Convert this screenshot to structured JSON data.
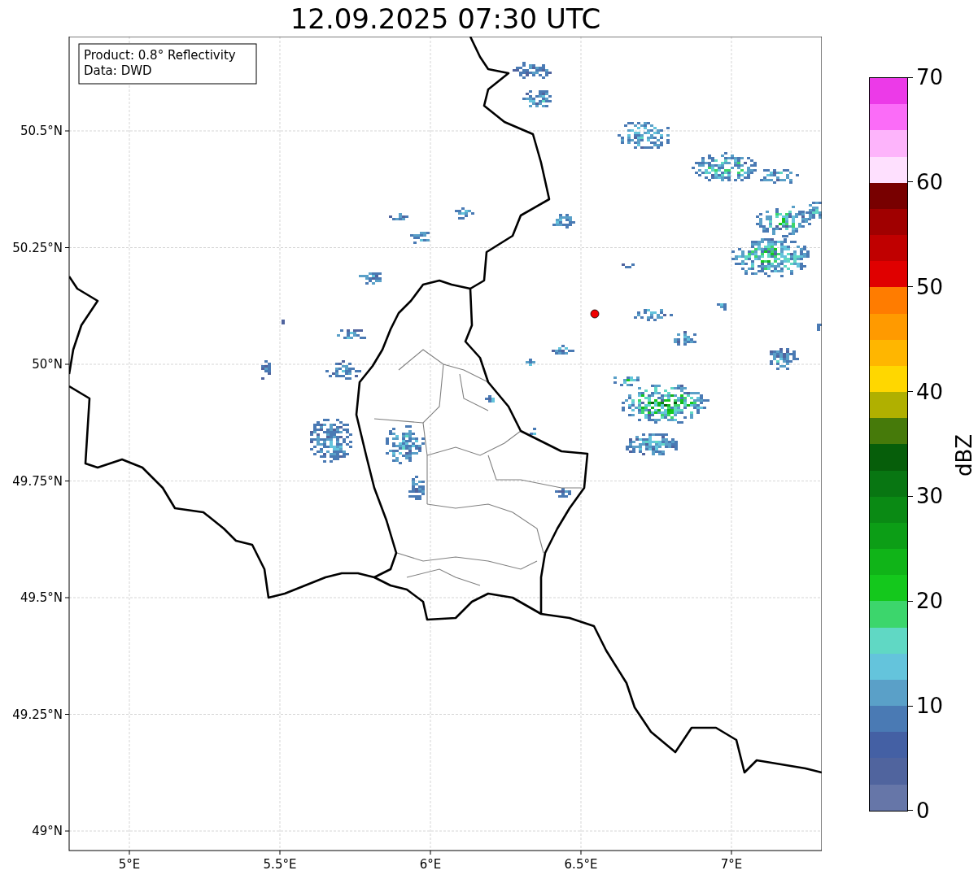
{
  "title": "12.09.2025 07:30 UTC",
  "legend": [
    "Product: 0.8° Reflectivity",
    "Data: DWD"
  ],
  "map": {
    "xticks": [
      "5°E",
      "5.5°E",
      "6°E",
      "6.5°E",
      "7°E"
    ],
    "yticks": [
      "50.5°N",
      "50.25°N",
      "50°N",
      "49.75°N",
      "49.5°N",
      "49.25°N",
      "49°N"
    ]
  },
  "colorbar": {
    "label": "dBZ",
    "ticks": [
      "70",
      "60",
      "50",
      "40",
      "30",
      "20",
      "10",
      "0"
    ],
    "segments": [
      {
        "color": "#ec3ae8"
      },
      {
        "color": "#fb6cf8"
      },
      {
        "color": "#fdb4fb"
      },
      {
        "color": "#fee0fe"
      },
      {
        "color": "#780000"
      },
      {
        "color": "#a00000"
      },
      {
        "color": "#c00000"
      },
      {
        "color": "#e00000"
      },
      {
        "color": "#ff7c00"
      },
      {
        "color": "#ff9a00"
      },
      {
        "color": "#ffb600"
      },
      {
        "color": "#ffd700"
      },
      {
        "color": "#b0b000"
      },
      {
        "color": "#467a0a"
      },
      {
        "color": "#065e0a"
      },
      {
        "color": "#087612"
      },
      {
        "color": "#0a8a14"
      },
      {
        "color": "#0c9e16"
      },
      {
        "color": "#10b418"
      },
      {
        "color": "#14c81c"
      },
      {
        "color": "#3cd66c"
      },
      {
        "color": "#60d8c4"
      },
      {
        "color": "#64c4dc"
      },
      {
        "color": "#5aa0c8"
      },
      {
        "color": "#4a7ab4"
      },
      {
        "color": "#4460a4"
      },
      {
        "color": "#50649e"
      },
      {
        "color": "#6676a8"
      }
    ]
  }
}
